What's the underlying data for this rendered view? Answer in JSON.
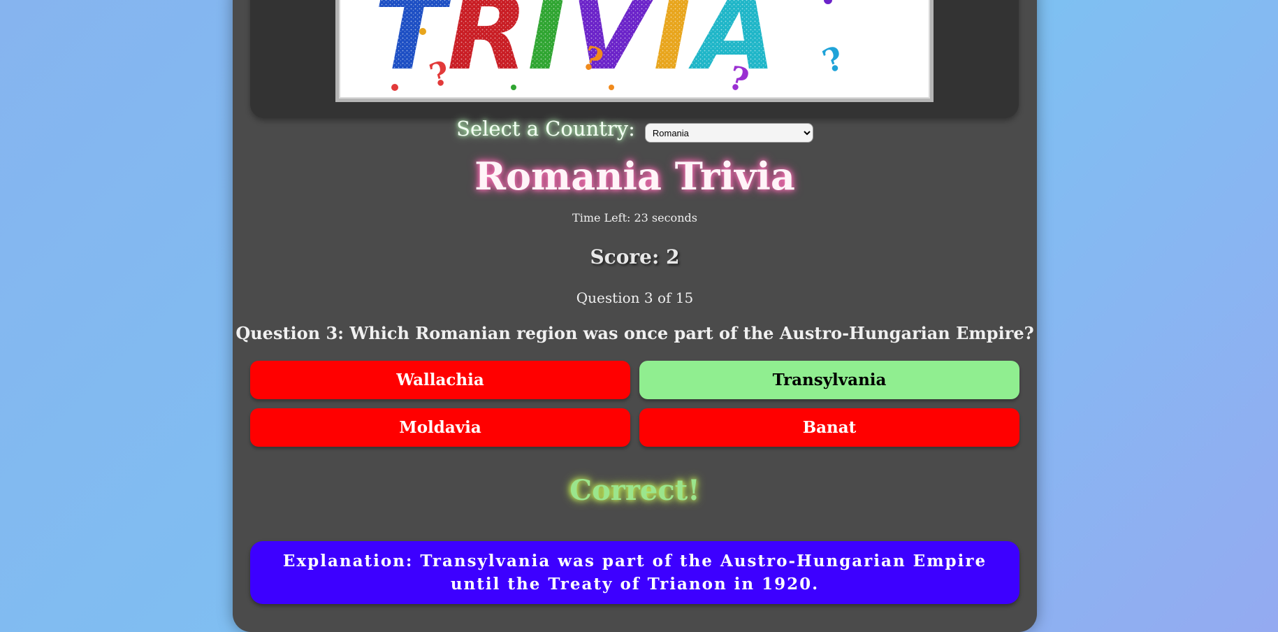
{
  "banner": {
    "wordmark": "TRIVIA"
  },
  "country_selector": {
    "label": "Select a Country:",
    "selected": "Romania",
    "options": [
      "Romania"
    ]
  },
  "quiz": {
    "title": "Romania Trivia",
    "time_left": "Time Left: 23 seconds",
    "score": "Score: 2",
    "progress": "Question 3 of 15",
    "question": "Question 3: Which Romanian region was once part of the Austro-Hungarian Empire?",
    "answers": [
      {
        "label": "Wallachia",
        "state": "incorrect"
      },
      {
        "label": "Transylvania",
        "state": "correct"
      },
      {
        "label": "Moldavia",
        "state": "incorrect"
      },
      {
        "label": "Banat",
        "state": "incorrect"
      }
    ],
    "feedback": "Correct!",
    "explanation": "Explanation: Transylvania was part of the Austro-Hungarian Empire until the Treaty of Trianon in 1920."
  },
  "colors": {
    "correct_answer": "#90ee90",
    "incorrect_answer": "#ff0000",
    "explanation_bg": "#3d00ff",
    "card_bg": "#4b4b4b",
    "banner_panel_bg": "#333333"
  }
}
